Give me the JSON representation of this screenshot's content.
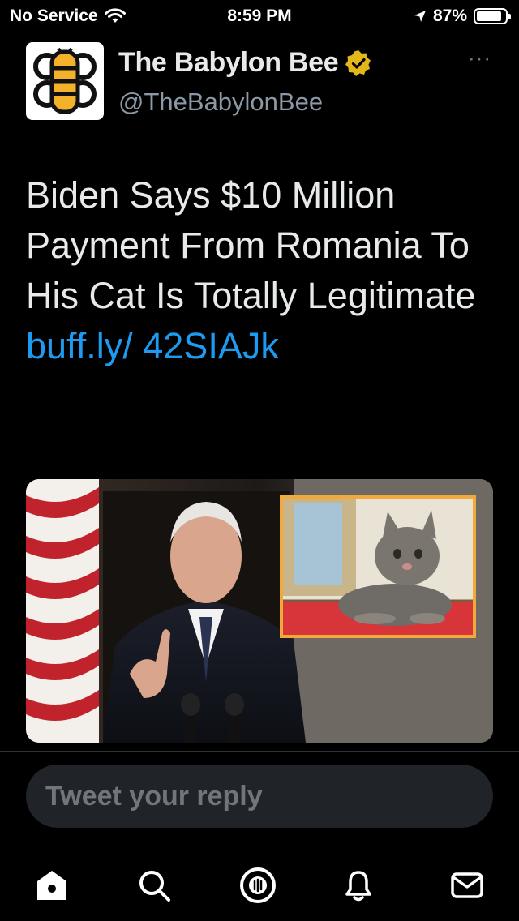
{
  "status_bar": {
    "carrier": "No Service",
    "time": "8:59 PM",
    "battery": "87%",
    "battery_level": 0.87
  },
  "tweet": {
    "display_name": "The Babylon Bee",
    "handle": "@TheBabylonBee",
    "verified": true,
    "more_label": "···",
    "text": "Biden Says $10 Million Payment From Romania To His Cat Is Totally Legitimate ",
    "link": "buff.ly/ 42SIAJk"
  },
  "reply": {
    "placeholder": "Tweet your reply"
  },
  "tabs": [
    {
      "icon": "home-icon"
    },
    {
      "icon": "search-icon"
    },
    {
      "icon": "spaces-icon"
    },
    {
      "icon": "notifications-icon"
    },
    {
      "icon": "messages-icon"
    }
  ],
  "colors": {
    "background": "#000000",
    "link": "#1d9bf0",
    "secondary_text": "#71767b",
    "verified_badge": "#e2b719"
  }
}
